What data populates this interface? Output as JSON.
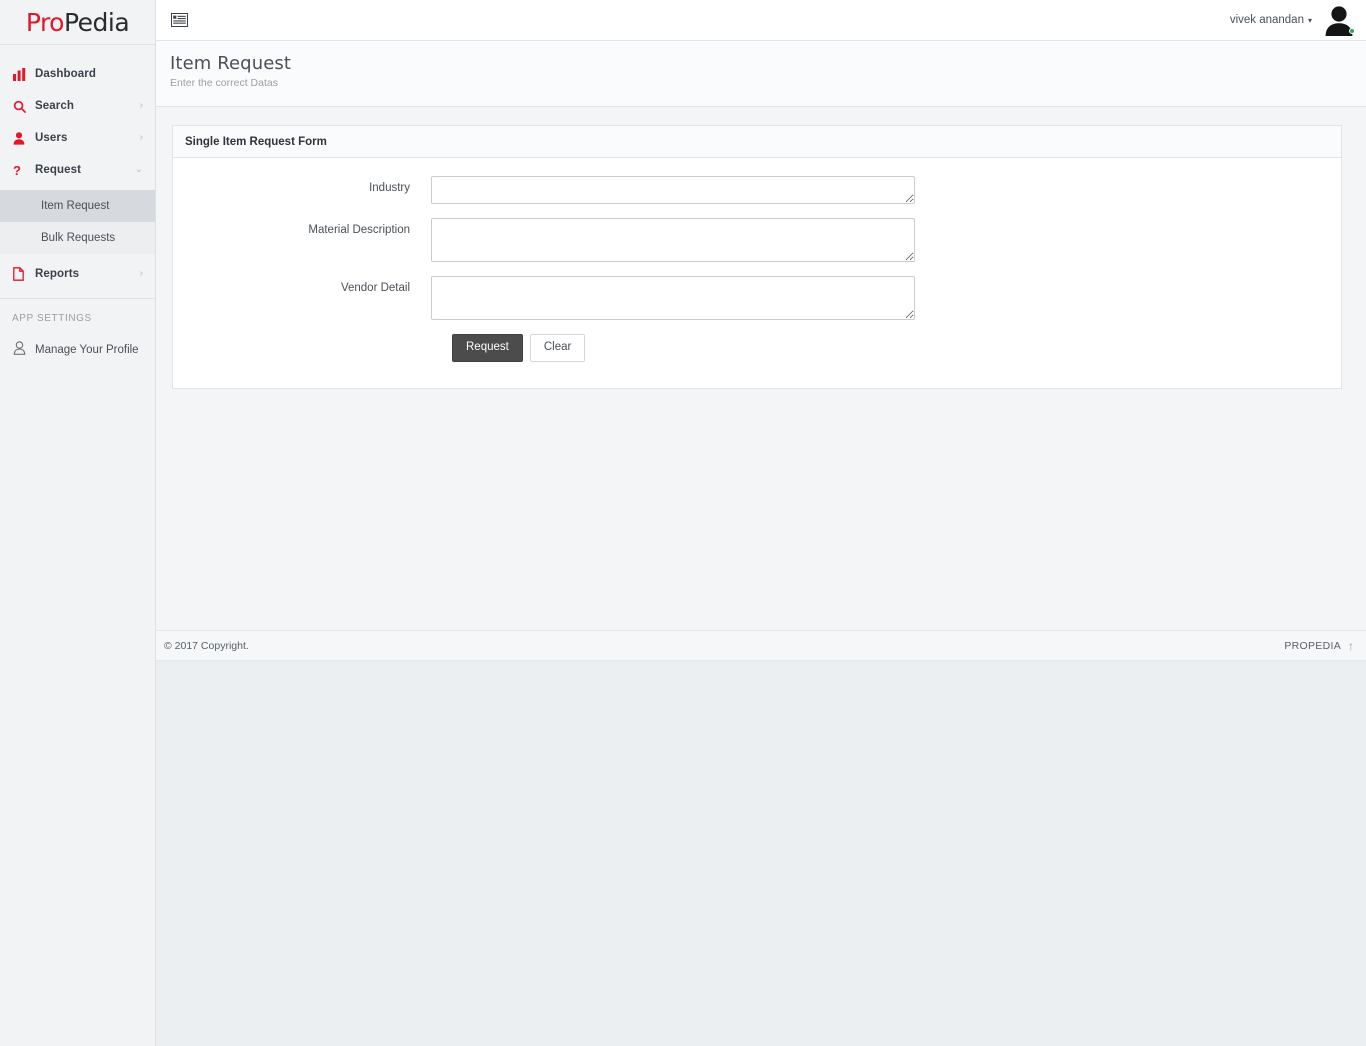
{
  "brand": {
    "logo_pro": "Pro",
    "logo_pedia": "Pedia",
    "accent_color": "#e8142a",
    "footer_brand": "PROPEDIA"
  },
  "topbar": {
    "menu_toggle_icon": "hamburger-icon",
    "user_name": "vivek anandan",
    "user_caret": "▾",
    "avatar_icon": "user-avatar-icon",
    "status_color": "#22b14c"
  },
  "sidebar": {
    "items": [
      {
        "label": "Dashboard",
        "icon": "bar-chart-icon",
        "caret": ""
      },
      {
        "label": "Search",
        "icon": "search-icon",
        "caret": "›"
      },
      {
        "label": "Users",
        "icon": "user-icon",
        "caret": "›"
      },
      {
        "label": "Request",
        "icon": "question-mark-icon",
        "caret": "⌄"
      }
    ],
    "sub_items": [
      {
        "label": "Item Request",
        "active": true
      },
      {
        "label": "Bulk Requests",
        "active": false
      }
    ],
    "reports": {
      "label": "Reports",
      "icon": "document-icon",
      "caret": "›"
    },
    "section_title": "APP SETTINGS",
    "profile": {
      "label": "Manage Your Profile",
      "icon": "person-outline-icon"
    }
  },
  "page": {
    "title": "Item Request",
    "subtitle": "Enter the correct Datas"
  },
  "form": {
    "panel_title": "Single Item Request Form",
    "fields": [
      {
        "label": "Industry",
        "value": "",
        "placeholder": ""
      },
      {
        "label": "Material Description",
        "value": "",
        "placeholder": ""
      },
      {
        "label": "Vendor Detail",
        "value": "",
        "placeholder": ""
      }
    ],
    "submit_label": "Request",
    "clear_label": "Clear"
  },
  "footer": {
    "copyright": "© 2017 Copyright.",
    "to_top_icon": "arrow-up-icon"
  }
}
